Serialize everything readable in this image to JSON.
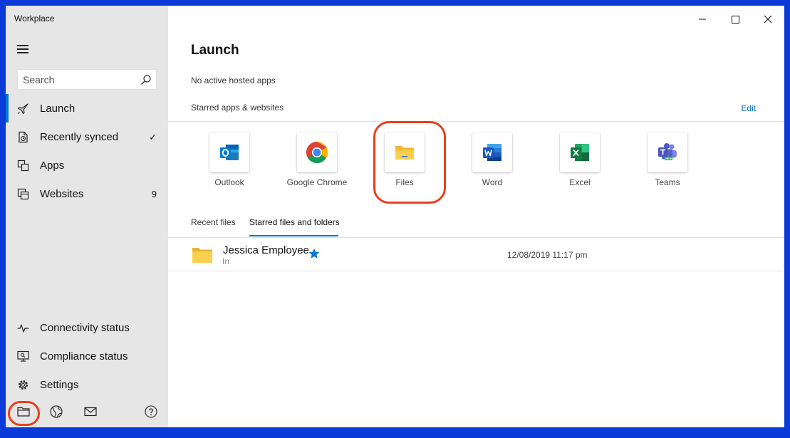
{
  "app": {
    "title": "Workplace"
  },
  "window_controls": {
    "minimize": "minimize-icon",
    "maximize": "maximize-icon",
    "close": "close-icon"
  },
  "sidebar": {
    "search": {
      "placeholder": "Search",
      "value": ""
    },
    "nav": [
      {
        "label": "Launch",
        "icon": "rocket-icon",
        "active": true
      },
      {
        "label": "Recently synced",
        "icon": "sync-icon",
        "right": "✓"
      },
      {
        "label": "Apps",
        "icon": "apps-icon"
      },
      {
        "label": "Websites",
        "icon": "websites-icon",
        "right": "9"
      }
    ],
    "bottom_nav": [
      {
        "label": "Connectivity status",
        "icon": "pulse-icon"
      },
      {
        "label": "Compliance status",
        "icon": "compliance-icon"
      },
      {
        "label": "Settings",
        "icon": "gear-icon"
      }
    ],
    "footer_icons": [
      "folder-icon",
      "globe-icon",
      "mail-icon",
      "help-icon"
    ]
  },
  "main": {
    "title": "Launch",
    "hosted_apps_text": "No active hosted apps",
    "starred_heading": "Starred apps & websites",
    "edit_label": "Edit",
    "apps": [
      {
        "name": "Outlook",
        "color": "#0078d4"
      },
      {
        "name": "Google Chrome",
        "color": "#db4437"
      },
      {
        "name": "Files",
        "color": "#f8c33c"
      },
      {
        "name": "Word",
        "color": "#2b579a"
      },
      {
        "name": "Excel",
        "color": "#217346"
      },
      {
        "name": "Teams",
        "color": "#5b5fc7"
      }
    ],
    "tabs": [
      {
        "label": "Recent files",
        "selected": false
      },
      {
        "label": "Starred files and folders",
        "selected": true
      }
    ],
    "files": [
      {
        "name": "Jessica Employee",
        "subtitle": "In",
        "date": "12/08/2019 11:17 pm",
        "starred": true
      }
    ]
  },
  "accent": "#0078d4",
  "highlight": "#e8401c"
}
